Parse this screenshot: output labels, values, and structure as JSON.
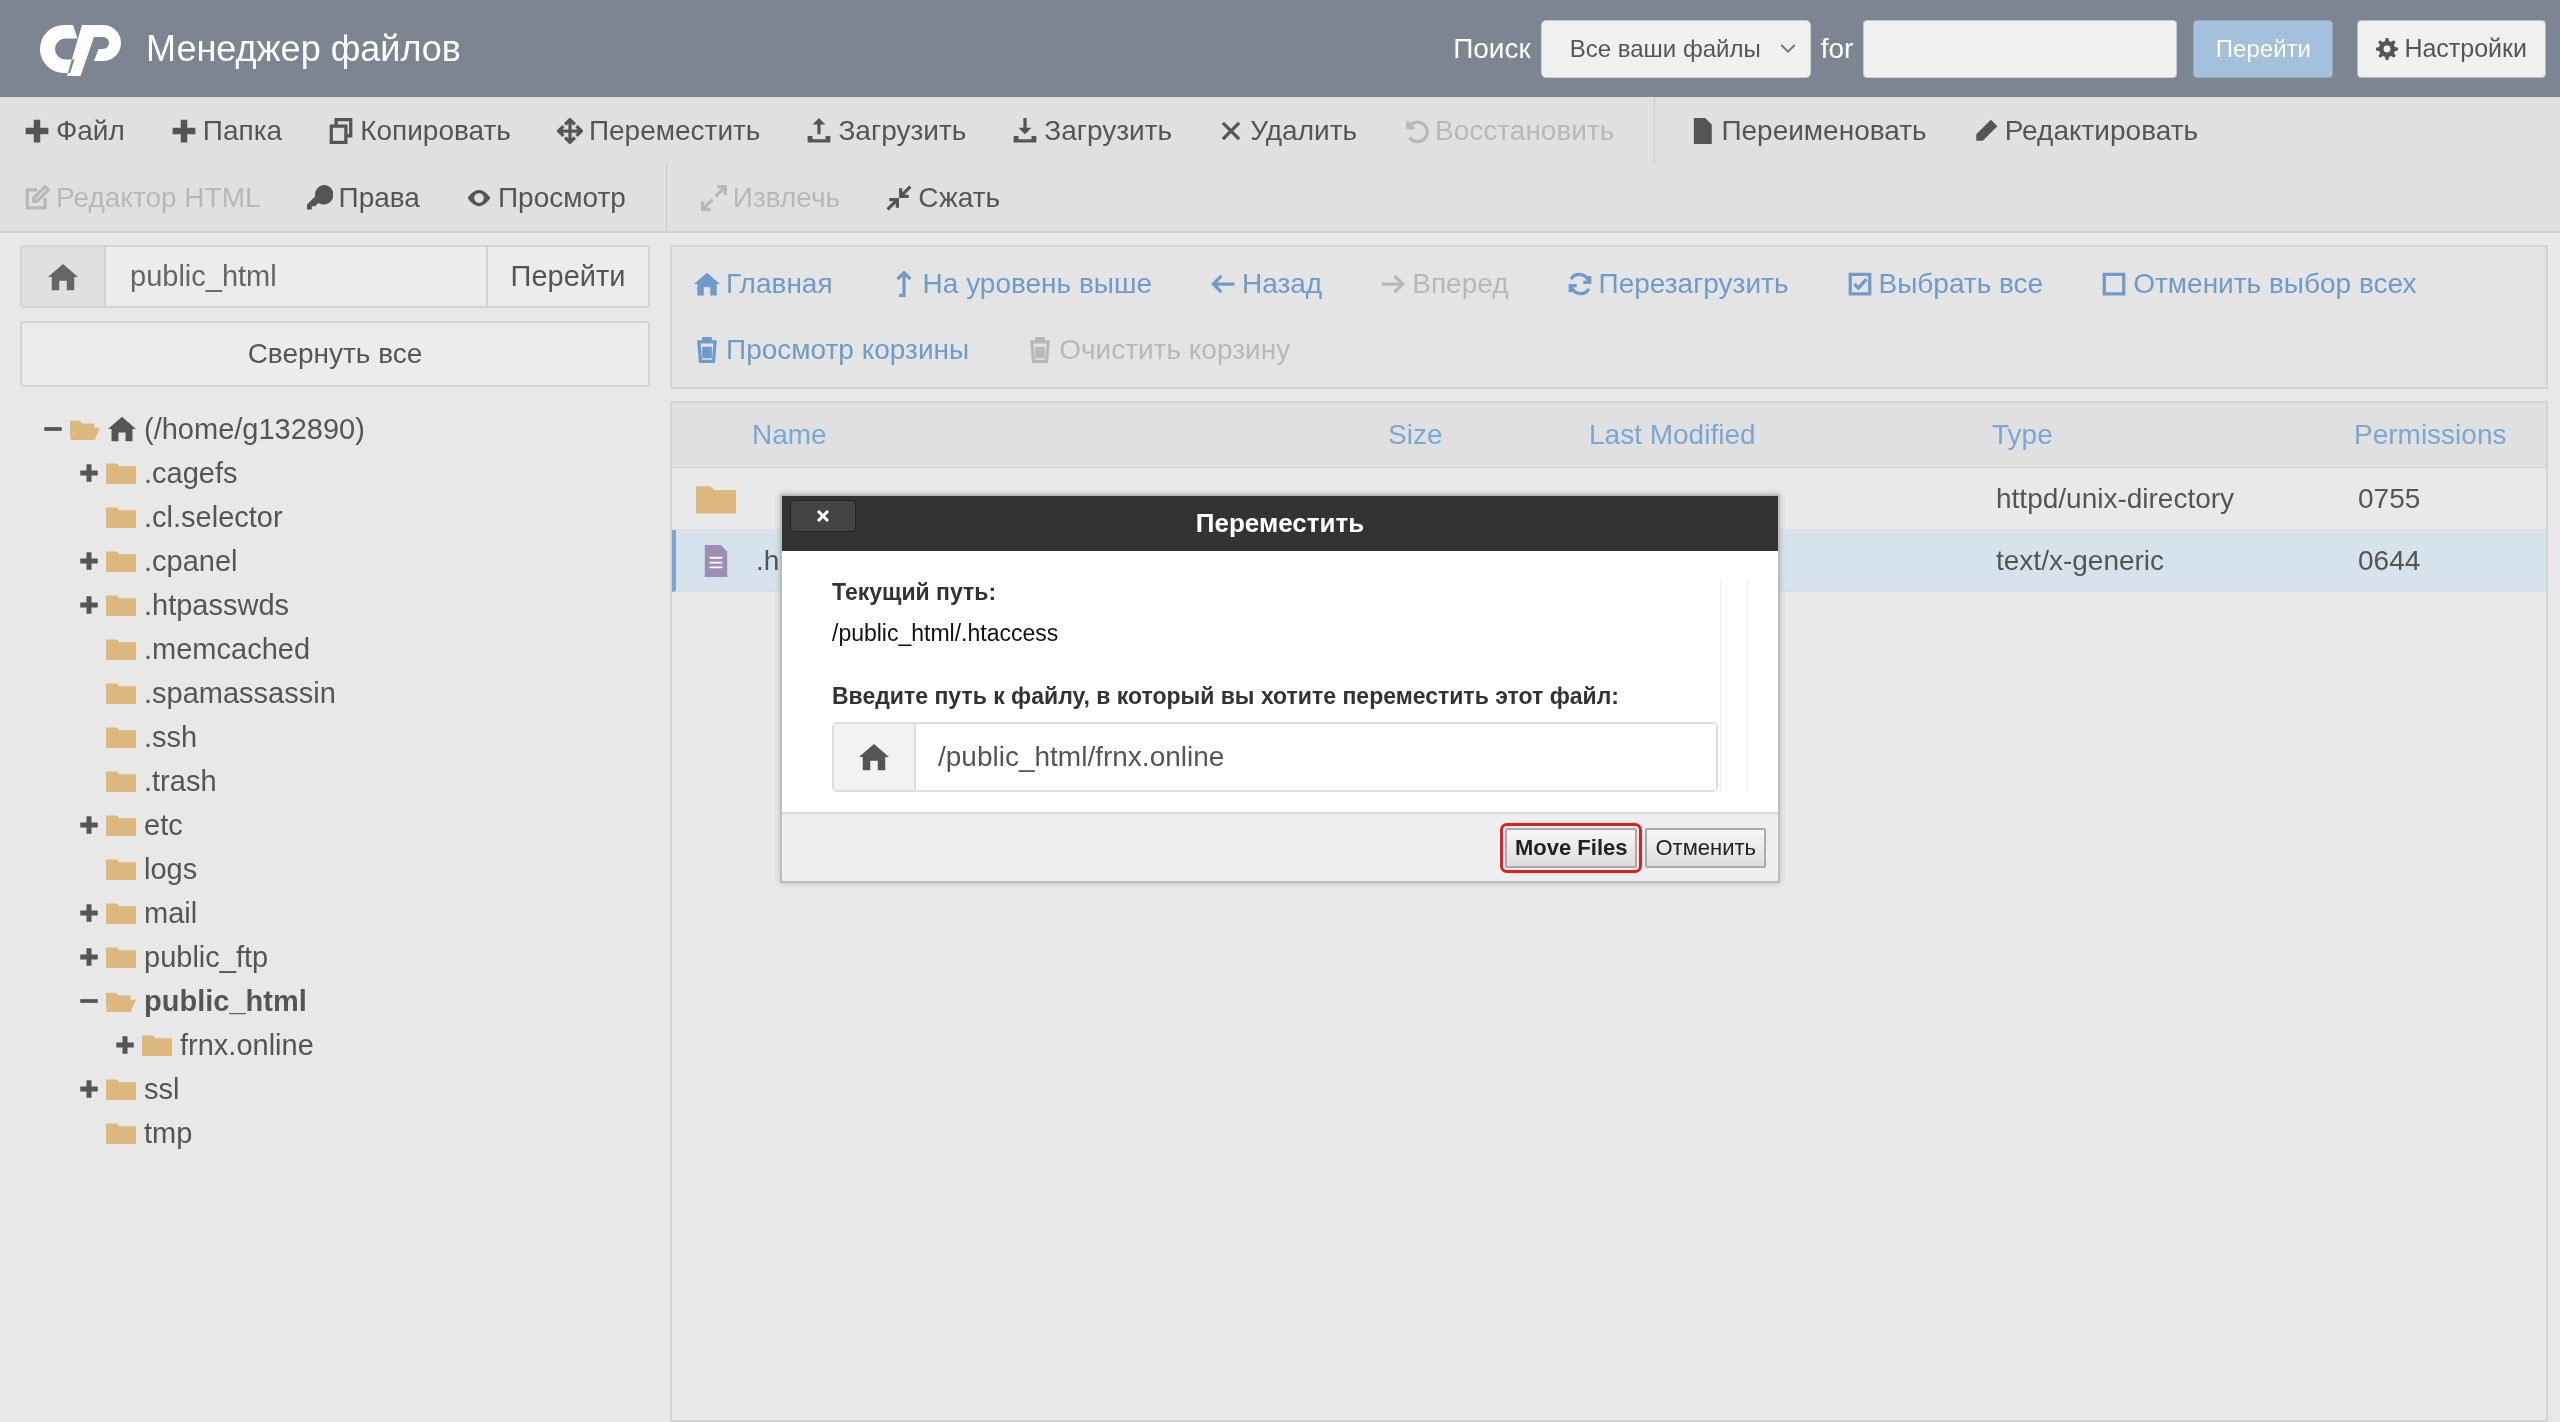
{
  "header": {
    "title": "Менеджер файлов",
    "search_label": "Поиск",
    "search_scope": "Все ваши файлы",
    "for_label": "for",
    "go": "Перейти",
    "settings": "Настройки"
  },
  "toolbar": {
    "rows": [
      {
        "groups": [
          {
            "items": [
              {
                "label": "Файл",
                "kind": "plus",
                "disabled": false
              },
              {
                "label": "Папка",
                "kind": "plus",
                "disabled": false
              },
              {
                "label": "Копировать",
                "kind": "copy",
                "disabled": false
              },
              {
                "label": "Переместить",
                "kind": "move",
                "disabled": false
              },
              {
                "label": "Загрузить",
                "kind": "upload",
                "disabled": false
              },
              {
                "label": "Загрузить",
                "kind": "download",
                "disabled": false
              },
              {
                "label": "Удалить",
                "kind": "cross",
                "disabled": false
              },
              {
                "label": "Восстановить",
                "kind": "undo",
                "disabled": true
              }
            ]
          },
          {
            "items": [
              {
                "label": "Переименовать",
                "kind": "file",
                "disabled": false
              },
              {
                "label": "Редактировать",
                "kind": "pencil",
                "disabled": false
              }
            ]
          }
        ]
      },
      {
        "groups": [
          {
            "items": [
              {
                "label": "Редактор HTML",
                "kind": "edit",
                "disabled": true
              },
              {
                "label": "Права",
                "kind": "key",
                "disabled": false
              },
              {
                "label": "Просмотр",
                "kind": "eye",
                "disabled": false
              }
            ]
          },
          {
            "items": [
              {
                "label": "Извлечь",
                "kind": "expand",
                "disabled": true
              },
              {
                "label": "Сжать",
                "kind": "compress",
                "disabled": false
              }
            ]
          }
        ]
      }
    ]
  },
  "path_bar": {
    "value": "public_html",
    "go": "Перейти"
  },
  "collapse_all": "Свернуть все",
  "tree": {
    "label": "(/home/g132890)",
    "kind": "home",
    "expandable": true,
    "expanded": true,
    "selected": false,
    "children": [
      {
        "label": ".cagefs",
        "expandable": true,
        "expanded": false,
        "selected": false
      },
      {
        "label": ".cl.selector",
        "expandable": false,
        "expanded": false,
        "selected": false
      },
      {
        "label": ".cpanel",
        "expandable": true,
        "expanded": false,
        "selected": false
      },
      {
        "label": ".htpasswds",
        "expandable": true,
        "expanded": false,
        "selected": false
      },
      {
        "label": ".memcached",
        "expandable": false,
        "expanded": false,
        "selected": false
      },
      {
        "label": ".spamassassin",
        "expandable": false,
        "expanded": false,
        "selected": false
      },
      {
        "label": ".ssh",
        "expandable": false,
        "expanded": false,
        "selected": false
      },
      {
        "label": ".trash",
        "expandable": false,
        "expanded": false,
        "selected": false
      },
      {
        "label": "etc",
        "expandable": true,
        "expanded": false,
        "selected": false
      },
      {
        "label": "logs",
        "expandable": false,
        "expanded": false,
        "selected": false
      },
      {
        "label": "mail",
        "expandable": true,
        "expanded": false,
        "selected": false
      },
      {
        "label": "public_ftp",
        "expandable": true,
        "expanded": false,
        "selected": false
      },
      {
        "label": "public_html",
        "expandable": true,
        "expanded": true,
        "selected": true,
        "children": [
          {
            "label": "frnx.online",
            "expandable": true,
            "expanded": false,
            "selected": false
          }
        ]
      },
      {
        "label": "ssl",
        "expandable": true,
        "expanded": false,
        "selected": false
      },
      {
        "label": "tmp",
        "expandable": false,
        "expanded": false,
        "selected": false
      }
    ]
  },
  "nav": {
    "rows": [
      [
        {
          "label": "Главная",
          "kind": "home",
          "disabled": false
        },
        {
          "label": "На уровень выше",
          "kind": "up",
          "disabled": false
        },
        {
          "label": "Назад",
          "kind": "left",
          "disabled": false
        },
        {
          "label": "Вперед",
          "kind": "right",
          "disabled": true
        },
        {
          "label": "Перезагрузить",
          "kind": "refresh",
          "disabled": false
        },
        {
          "label": "Выбрать все",
          "kind": "checkbox",
          "disabled": false
        },
        {
          "label": "Отменить выбор всех",
          "kind": "box",
          "disabled": false
        }
      ],
      [
        {
          "label": "Просмотр корзины",
          "kind": "trash",
          "disabled": false
        },
        {
          "label": "Очистить корзину",
          "kind": "trash",
          "disabled": true
        }
      ]
    ]
  },
  "table": {
    "columns": [
      "Name",
      "Size",
      "Last Modified",
      "Type",
      "Permissions"
    ],
    "rows": [
      {
        "kind": "folder",
        "selected": false,
        "type": "httpd/unix-directory",
        "permissions": "0755"
      },
      {
        "kind": "file",
        "selected": true,
        "name": ".h",
        "type": "text/x-generic",
        "permissions": "0644"
      }
    ]
  },
  "dialog": {
    "title": "Переместить",
    "current_label": "Текущий путь:",
    "current_path": "/public_html/.htaccess",
    "dest_label": "Введите путь к файлу, в который вы хотите переместить этот файл:",
    "dest_value": "/public_html/frnx.online",
    "buttons": [
      {
        "label": "Move Files",
        "kind": "primary",
        "focused": true
      },
      {
        "label": "Отменить",
        "kind": "secondary",
        "focused": false
      }
    ]
  }
}
